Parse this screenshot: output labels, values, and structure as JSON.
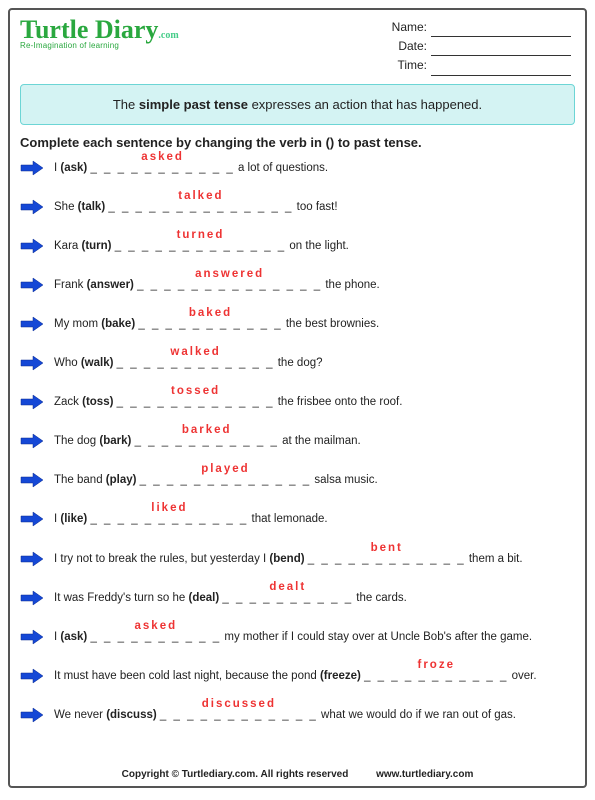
{
  "logo": {
    "main": "Turtle Diary",
    "suffix": ".com",
    "tagline": "Re-Imagination of learning"
  },
  "fields": {
    "name": "Name:",
    "date": "Date:",
    "time": "Time:"
  },
  "explain": {
    "pre": "The ",
    "bold": "simple past tense",
    "post": " expresses an action that has happened."
  },
  "instructions": "Complete each sentence by changing the verb in () to past tense.",
  "questions": [
    {
      "pre": "I ",
      "verb": "(ask)",
      "blank": "_ _ _ _ _ _ _ _ _ _ _",
      "answer": "asked",
      "post": " a lot of questions."
    },
    {
      "pre": "She ",
      "verb": "(talk)",
      "blank": "_ _ _ _ _ _ _ _ _ _ _ _ _ _",
      "answer": "talked",
      "post": " too fast!"
    },
    {
      "pre": "Kara ",
      "verb": "(turn)",
      "blank": "_ _ _ _ _ _ _ _ _ _ _ _ _",
      "answer": "turned",
      "post": " on the light."
    },
    {
      "pre": "Frank ",
      "verb": "(answer)",
      "blank": "_ _ _ _ _ _ _ _ _ _ _ _ _ _",
      "answer": "answered",
      "post": " the phone."
    },
    {
      "pre": "My mom ",
      "verb": "(bake)",
      "blank": "_ _ _ _ _ _ _ _ _ _ _",
      "answer": "baked",
      "post": " the best brownies."
    },
    {
      "pre": "Who ",
      "verb": "(walk)",
      "blank": "_ _ _ _ _ _ _ _ _ _ _ _",
      "answer": "walked",
      "post": " the dog?"
    },
    {
      "pre": "Zack ",
      "verb": "(toss)",
      "blank": "_ _ _ _ _ _ _ _ _ _ _ _",
      "answer": "tossed",
      "post": " the frisbee onto the roof."
    },
    {
      "pre": "The dog ",
      "verb": "(bark)",
      "blank": "_ _ _ _ _ _ _ _ _ _ _",
      "answer": "barked",
      "post": " at the mailman."
    },
    {
      "pre": "The band ",
      "verb": "(play)",
      "blank": "_ _ _ _ _ _ _ _ _ _ _ _ _",
      "answer": "played",
      "post": " salsa music."
    },
    {
      "pre": "I ",
      "verb": "(like)",
      "blank": "_ _ _ _ _ _ _ _ _ _ _ _",
      "answer": "liked",
      "post": " that lemonade."
    },
    {
      "pre": "I try not to break the rules, but yesterday I ",
      "verb": "(bend)",
      "blank": " _ _ _ _ _ _ _ _ _ _ _ _",
      "answer": "bent",
      "post": " them a bit."
    },
    {
      "pre": "It was Freddy's turn so he ",
      "verb": "(deal)",
      "blank": " _ _ _ _ _ _ _ _ _ _",
      "answer": "dealt",
      "post": " the cards."
    },
    {
      "pre": "I ",
      "verb": "(ask)",
      "blank": " _ _ _ _ _ _ _ _ _ _",
      "answer": "asked",
      "post": " my mother if I could stay over at Uncle Bob's after the game."
    },
    {
      "pre": "It must have been cold last night, because the pond ",
      "verb": "(freeze)",
      "blank": " _ _ _ _ _ _ _ _ _ _ _",
      "answer": "froze",
      "post": " over."
    },
    {
      "pre": "We never ",
      "verb": "(discuss)",
      "blank": " _ _ _ _ _ _ _ _ _ _ _ _",
      "answer": "discussed",
      "post": " what we would do if we ran out of gas."
    }
  ],
  "footer": {
    "left": "Copyright © Turtlediary.com. All rights reserved",
    "right": "www.turtlediary.com"
  }
}
